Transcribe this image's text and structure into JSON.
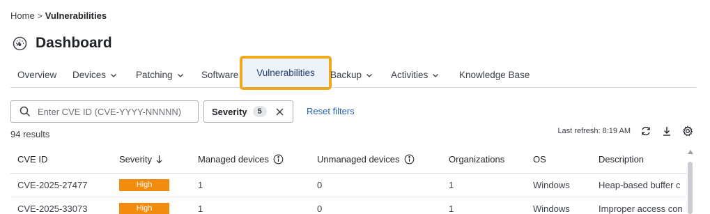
{
  "breadcrumb": {
    "home": "Home",
    "separator": ">",
    "current": "Vulnerabilities"
  },
  "header": {
    "title": "Dashboard",
    "icon": "dashboard-gauge-icon"
  },
  "tabs": [
    {
      "label": "Overview",
      "has_dropdown": false
    },
    {
      "label": "Devices",
      "has_dropdown": true
    },
    {
      "label": "Patching",
      "has_dropdown": true
    },
    {
      "label": "Software",
      "has_dropdown": false
    },
    {
      "label": "Vulnerabilities",
      "has_dropdown": false,
      "active": true
    },
    {
      "label": "Backup",
      "has_dropdown": true
    },
    {
      "label": "Activities",
      "has_dropdown": true
    },
    {
      "label": "Knowledge Base",
      "has_dropdown": false
    }
  ],
  "search": {
    "placeholder": "Enter CVE ID (CVE-YYYY-NNNNN)",
    "value": ""
  },
  "filters": {
    "severity_label": "Severity",
    "severity_count": "5",
    "reset_label": "Reset filters"
  },
  "results": {
    "count_text": "94 results"
  },
  "toolbar": {
    "last_refresh": "Last refresh: 8:19 AM"
  },
  "table": {
    "columns": [
      "CVE ID",
      "Severity",
      "Managed devices",
      "Unmanaged devices",
      "Organizations",
      "OS",
      "Description"
    ],
    "rows": [
      {
        "cve_id": "CVE-2025-27477",
        "severity": "High",
        "managed": "1",
        "unmanaged": "0",
        "organizations": "1",
        "os": "Windows",
        "description": "Heap-based buffer c"
      },
      {
        "cve_id": "CVE-2025-33073",
        "severity": "High",
        "managed": "1",
        "unmanaged": "0",
        "organizations": "1",
        "os": "Windows",
        "description": "Improper access con"
      }
    ]
  },
  "colors": {
    "accent_highlight": "#f0a91c",
    "severity_high": "#f28c0f",
    "link": "#2062a8"
  }
}
